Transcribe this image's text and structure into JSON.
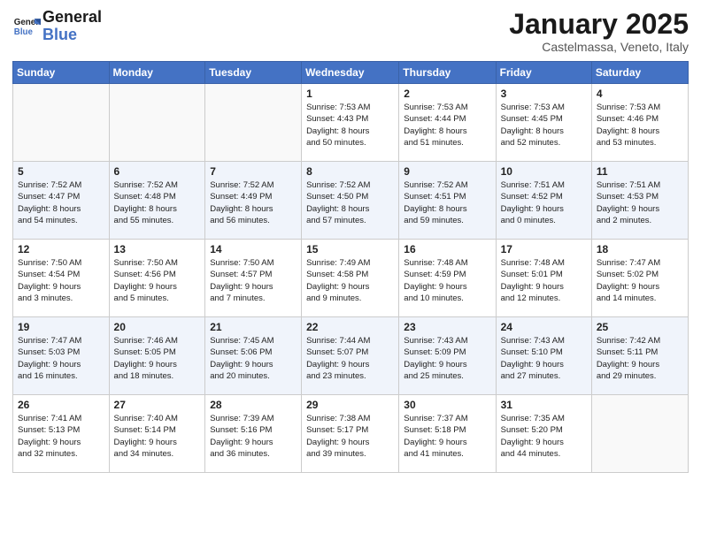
{
  "header": {
    "logo_line1": "General",
    "logo_line2": "Blue",
    "month_title": "January 2025",
    "location": "Castelmassa, Veneto, Italy"
  },
  "days_of_week": [
    "Sunday",
    "Monday",
    "Tuesday",
    "Wednesday",
    "Thursday",
    "Friday",
    "Saturday"
  ],
  "weeks": [
    [
      {
        "day": "",
        "info": ""
      },
      {
        "day": "",
        "info": ""
      },
      {
        "day": "",
        "info": ""
      },
      {
        "day": "1",
        "info": "Sunrise: 7:53 AM\nSunset: 4:43 PM\nDaylight: 8 hours\nand 50 minutes."
      },
      {
        "day": "2",
        "info": "Sunrise: 7:53 AM\nSunset: 4:44 PM\nDaylight: 8 hours\nand 51 minutes."
      },
      {
        "day": "3",
        "info": "Sunrise: 7:53 AM\nSunset: 4:45 PM\nDaylight: 8 hours\nand 52 minutes."
      },
      {
        "day": "4",
        "info": "Sunrise: 7:53 AM\nSunset: 4:46 PM\nDaylight: 8 hours\nand 53 minutes."
      }
    ],
    [
      {
        "day": "5",
        "info": "Sunrise: 7:52 AM\nSunset: 4:47 PM\nDaylight: 8 hours\nand 54 minutes."
      },
      {
        "day": "6",
        "info": "Sunrise: 7:52 AM\nSunset: 4:48 PM\nDaylight: 8 hours\nand 55 minutes."
      },
      {
        "day": "7",
        "info": "Sunrise: 7:52 AM\nSunset: 4:49 PM\nDaylight: 8 hours\nand 56 minutes."
      },
      {
        "day": "8",
        "info": "Sunrise: 7:52 AM\nSunset: 4:50 PM\nDaylight: 8 hours\nand 57 minutes."
      },
      {
        "day": "9",
        "info": "Sunrise: 7:52 AM\nSunset: 4:51 PM\nDaylight: 8 hours\nand 59 minutes."
      },
      {
        "day": "10",
        "info": "Sunrise: 7:51 AM\nSunset: 4:52 PM\nDaylight: 9 hours\nand 0 minutes."
      },
      {
        "day": "11",
        "info": "Sunrise: 7:51 AM\nSunset: 4:53 PM\nDaylight: 9 hours\nand 2 minutes."
      }
    ],
    [
      {
        "day": "12",
        "info": "Sunrise: 7:50 AM\nSunset: 4:54 PM\nDaylight: 9 hours\nand 3 minutes."
      },
      {
        "day": "13",
        "info": "Sunrise: 7:50 AM\nSunset: 4:56 PM\nDaylight: 9 hours\nand 5 minutes."
      },
      {
        "day": "14",
        "info": "Sunrise: 7:50 AM\nSunset: 4:57 PM\nDaylight: 9 hours\nand 7 minutes."
      },
      {
        "day": "15",
        "info": "Sunrise: 7:49 AM\nSunset: 4:58 PM\nDaylight: 9 hours\nand 9 minutes."
      },
      {
        "day": "16",
        "info": "Sunrise: 7:48 AM\nSunset: 4:59 PM\nDaylight: 9 hours\nand 10 minutes."
      },
      {
        "day": "17",
        "info": "Sunrise: 7:48 AM\nSunset: 5:01 PM\nDaylight: 9 hours\nand 12 minutes."
      },
      {
        "day": "18",
        "info": "Sunrise: 7:47 AM\nSunset: 5:02 PM\nDaylight: 9 hours\nand 14 minutes."
      }
    ],
    [
      {
        "day": "19",
        "info": "Sunrise: 7:47 AM\nSunset: 5:03 PM\nDaylight: 9 hours\nand 16 minutes."
      },
      {
        "day": "20",
        "info": "Sunrise: 7:46 AM\nSunset: 5:05 PM\nDaylight: 9 hours\nand 18 minutes."
      },
      {
        "day": "21",
        "info": "Sunrise: 7:45 AM\nSunset: 5:06 PM\nDaylight: 9 hours\nand 20 minutes."
      },
      {
        "day": "22",
        "info": "Sunrise: 7:44 AM\nSunset: 5:07 PM\nDaylight: 9 hours\nand 23 minutes."
      },
      {
        "day": "23",
        "info": "Sunrise: 7:43 AM\nSunset: 5:09 PM\nDaylight: 9 hours\nand 25 minutes."
      },
      {
        "day": "24",
        "info": "Sunrise: 7:43 AM\nSunset: 5:10 PM\nDaylight: 9 hours\nand 27 minutes."
      },
      {
        "day": "25",
        "info": "Sunrise: 7:42 AM\nSunset: 5:11 PM\nDaylight: 9 hours\nand 29 minutes."
      }
    ],
    [
      {
        "day": "26",
        "info": "Sunrise: 7:41 AM\nSunset: 5:13 PM\nDaylight: 9 hours\nand 32 minutes."
      },
      {
        "day": "27",
        "info": "Sunrise: 7:40 AM\nSunset: 5:14 PM\nDaylight: 9 hours\nand 34 minutes."
      },
      {
        "day": "28",
        "info": "Sunrise: 7:39 AM\nSunset: 5:16 PM\nDaylight: 9 hours\nand 36 minutes."
      },
      {
        "day": "29",
        "info": "Sunrise: 7:38 AM\nSunset: 5:17 PM\nDaylight: 9 hours\nand 39 minutes."
      },
      {
        "day": "30",
        "info": "Sunrise: 7:37 AM\nSunset: 5:18 PM\nDaylight: 9 hours\nand 41 minutes."
      },
      {
        "day": "31",
        "info": "Sunrise: 7:35 AM\nSunset: 5:20 PM\nDaylight: 9 hours\nand 44 minutes."
      },
      {
        "day": "",
        "info": ""
      }
    ]
  ]
}
